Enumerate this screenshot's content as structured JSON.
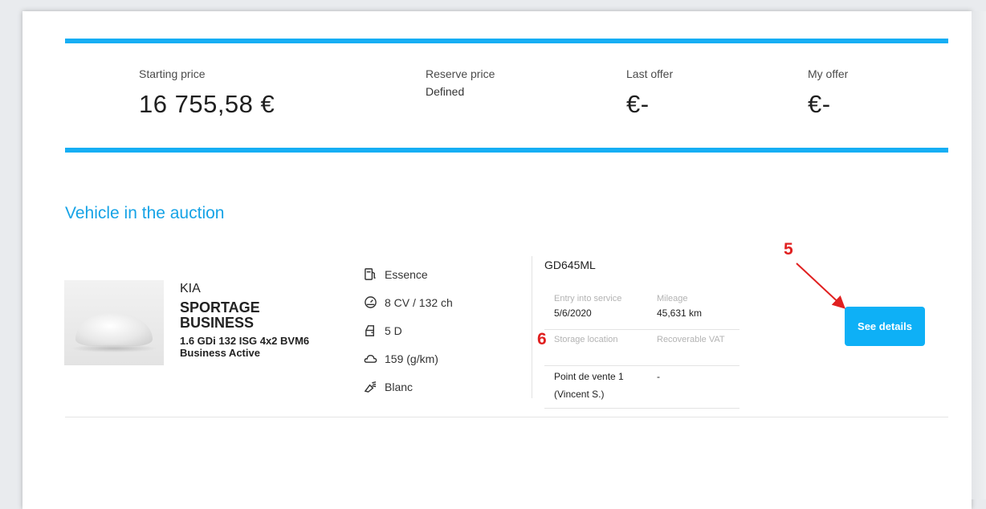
{
  "prices": {
    "starting": {
      "label": "Starting price",
      "value": "16 755,58 €"
    },
    "reserve": {
      "label": "Reserve price",
      "value": "Defined"
    },
    "last_offer": {
      "label": "Last offer",
      "value": "€-"
    },
    "my_offer": {
      "label": "My offer",
      "value": "€-"
    }
  },
  "section_title": "Vehicle in the auction",
  "vehicle": {
    "make": "KIA",
    "model": "SPORTAGE BUSINESS",
    "version_line1": "1.6 GDi 132 ISG 4x2 BVM6",
    "version_line2": "Business Active",
    "specs": {
      "fuel": "Essence",
      "power": "8 CV / 132 ch",
      "doors": "5 D",
      "co2": "159 (g/km)",
      "color": "Blanc"
    },
    "plate": "GD645ML",
    "info": {
      "entry_label": "Entry into service",
      "entry_value": "5/6/2020",
      "mileage_label": "Mileage",
      "mileage_value": "45,631 km",
      "storage_label": "Storage location",
      "storage_value_line1": "Point de vente 1",
      "storage_value_line2": "(Vincent S.)",
      "vat_label": "Recoverable VAT",
      "vat_value": "-"
    }
  },
  "actions": {
    "see_details": "See details"
  },
  "annotations": {
    "five": "5",
    "six": "6"
  },
  "colors": {
    "accent": "#16aef4",
    "button": "#0eb0f6",
    "annotation": "#e02020"
  }
}
